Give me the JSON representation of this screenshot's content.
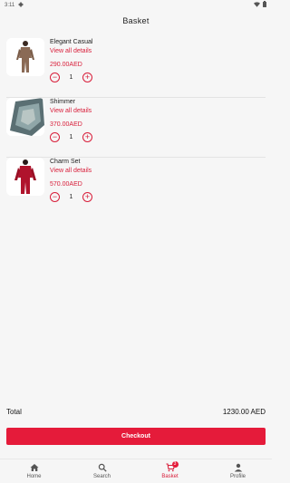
{
  "status_bar": {
    "time": "3:11",
    "settings_icon": "gear-icon",
    "wifi_icon": "wifi-icon",
    "battery_icon": "battery-icon"
  },
  "header": {
    "title": "Basket"
  },
  "items": [
    {
      "name": "Elegant Casual",
      "details_label": "View all details",
      "price": "290.00AED",
      "quantity": "1",
      "image_icon": "product-image"
    },
    {
      "name": "Shimmer",
      "details_label": "View all details",
      "price": "370.00AED",
      "quantity": "1",
      "image_icon": "product-image"
    },
    {
      "name": "Charm Set",
      "details_label": "View all details",
      "price": "570.00AED",
      "quantity": "1",
      "image_icon": "product-image"
    }
  ],
  "summary": {
    "total_label": "Total",
    "total_value": "1230.00 AED"
  },
  "checkout": {
    "label": "Checkout"
  },
  "nav": {
    "items": [
      {
        "label": "Home",
        "icon": "home-icon"
      },
      {
        "label": "Search",
        "icon": "search-icon"
      },
      {
        "label": "Basket",
        "icon": "cart-icon",
        "badge": "3"
      },
      {
        "label": "Profile",
        "icon": "person-icon"
      }
    ],
    "active_index": 2
  },
  "colors": {
    "accent": "#e51b3a",
    "background": "#f6f6f6"
  }
}
